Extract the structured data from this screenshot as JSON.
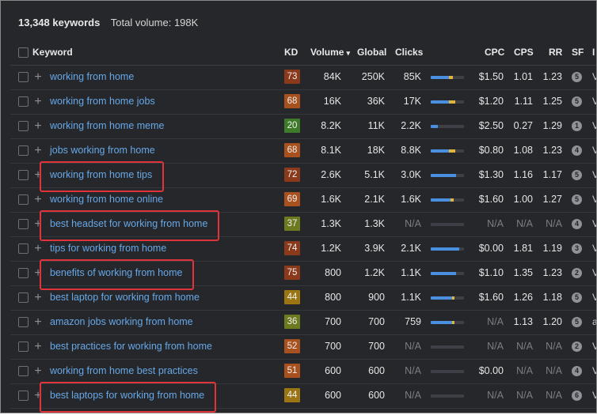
{
  "summary": {
    "count": "13,348 keywords",
    "volume": "Total volume: 198K"
  },
  "headers": {
    "keyword": "Keyword",
    "kd": "KD",
    "volume": "Volume",
    "sort_arrow": "▾",
    "global": "Global",
    "clicks": "Clicks",
    "cpc": "CPC",
    "cps": "CPS",
    "rr": "RR",
    "sf": "SF",
    "trunc": "I"
  },
  "colors": {
    "kd_brown": "#8a3a1a",
    "kd_orange": "#a8511f",
    "kd_green": "#3d7a2a",
    "kd_olive": "#6d7a1f",
    "kd_mustard": "#9a7512",
    "highlight": "#e0333a",
    "link": "#67a8e8"
  },
  "rows": [
    {
      "keyword": "working from home",
      "kd": "73",
      "kd_color": "#8a3a1a",
      "volume": "84K",
      "global": "250K",
      "clicks": "85K",
      "bar": [
        0.55,
        0.12
      ],
      "cpc": "$1.50",
      "cps": "1.01",
      "rr": "1.23",
      "sf": "5",
      "trunc": "V",
      "highlight": false
    },
    {
      "keyword": "working from home jobs",
      "kd": "68",
      "kd_color": "#a8511f",
      "volume": "16K",
      "global": "36K",
      "clicks": "17K",
      "bar": [
        0.55,
        0.2
      ],
      "cpc": "$1.20",
      "cps": "1.11",
      "rr": "1.25",
      "sf": "5",
      "trunc": "V",
      "highlight": false
    },
    {
      "keyword": "working from home meme",
      "kd": "20",
      "kd_color": "#3d7a2a",
      "volume": "8.2K",
      "global": "11K",
      "clicks": "2.2K",
      "bar": [
        0.22,
        0
      ],
      "cpc": "$2.50",
      "cps": "0.27",
      "rr": "1.29",
      "sf": "1",
      "trunc": "V",
      "highlight": false
    },
    {
      "keyword": "jobs working from home",
      "kd": "68",
      "kd_color": "#a8511f",
      "volume": "8.1K",
      "global": "18K",
      "clicks": "8.8K",
      "bar": [
        0.55,
        0.2
      ],
      "cpc": "$0.80",
      "cps": "1.08",
      "rr": "1.23",
      "sf": "4",
      "trunc": "V",
      "highlight": false
    },
    {
      "keyword": "working from home tips",
      "kd": "72",
      "kd_color": "#8a3a1a",
      "volume": "2.6K",
      "global": "5.1K",
      "clicks": "3.0K",
      "bar": [
        0.75,
        0
      ],
      "cpc": "$1.30",
      "cps": "1.16",
      "rr": "1.17",
      "sf": "5",
      "trunc": "V",
      "highlight": true
    },
    {
      "keyword": "working from home online",
      "kd": "69",
      "kd_color": "#a8511f",
      "volume": "1.6K",
      "global": "2.1K",
      "clicks": "1.6K",
      "bar": [
        0.6,
        0.08
      ],
      "cpc": "$1.60",
      "cps": "1.00",
      "rr": "1.27",
      "sf": "5",
      "trunc": "V",
      "highlight": false
    },
    {
      "keyword": "best headset for working from home",
      "kd": "37",
      "kd_color": "#6d7a1f",
      "volume": "1.3K",
      "global": "1.3K",
      "clicks": "N/A",
      "bar": null,
      "cpc": "N/A",
      "cps": "N/A",
      "rr": "N/A",
      "sf": "4",
      "trunc": "V",
      "highlight": true
    },
    {
      "keyword": "tips for working from home",
      "kd": "74",
      "kd_color": "#8a3a1a",
      "volume": "1.2K",
      "global": "3.9K",
      "clicks": "2.1K",
      "bar": [
        0.85,
        0
      ],
      "cpc": "$0.00",
      "cps": "1.81",
      "rr": "1.19",
      "sf": "3",
      "trunc": "V",
      "highlight": false
    },
    {
      "keyword": "benefits of working from home",
      "kd": "75",
      "kd_color": "#8a3a1a",
      "volume": "800",
      "global": "1.2K",
      "clicks": "1.1K",
      "bar": [
        0.75,
        0
      ],
      "cpc": "$1.10",
      "cps": "1.35",
      "rr": "1.23",
      "sf": "2",
      "trunc": "V",
      "highlight": true
    },
    {
      "keyword": "best laptop for working from home",
      "kd": "44",
      "kd_color": "#9a7512",
      "volume": "800",
      "global": "900",
      "clicks": "1.1K",
      "bar": [
        0.65,
        0.06
      ],
      "cpc": "$1.60",
      "cps": "1.26",
      "rr": "1.18",
      "sf": "5",
      "trunc": "V",
      "highlight": false
    },
    {
      "keyword": "amazon jobs working from home",
      "kd": "36",
      "kd_color": "#6d7a1f",
      "volume": "700",
      "global": "700",
      "clicks": "759",
      "bar": [
        0.65,
        0.06
      ],
      "cpc": "N/A",
      "cps": "1.13",
      "rr": "1.20",
      "sf": "5",
      "trunc": "a",
      "highlight": false
    },
    {
      "keyword": "best practices for working from home",
      "kd": "52",
      "kd_color": "#a8511f",
      "volume": "700",
      "global": "700",
      "clicks": "N/A",
      "bar": null,
      "cpc": "N/A",
      "cps": "N/A",
      "rr": "N/A",
      "sf": "2",
      "trunc": "V",
      "highlight": false
    },
    {
      "keyword": "working from home best practices",
      "kd": "51",
      "kd_color": "#a8511f",
      "volume": "600",
      "global": "600",
      "clicks": "N/A",
      "bar": null,
      "cpc": "$0.00",
      "cps": "N/A",
      "rr": "N/A",
      "sf": "4",
      "trunc": "V",
      "highlight": false
    },
    {
      "keyword": "best laptops for working from home",
      "kd": "44",
      "kd_color": "#9a7512",
      "volume": "600",
      "global": "600",
      "clicks": "N/A",
      "bar": null,
      "cpc": "N/A",
      "cps": "N/A",
      "rr": "N/A",
      "sf": "6",
      "trunc": "V",
      "highlight": true
    }
  ]
}
